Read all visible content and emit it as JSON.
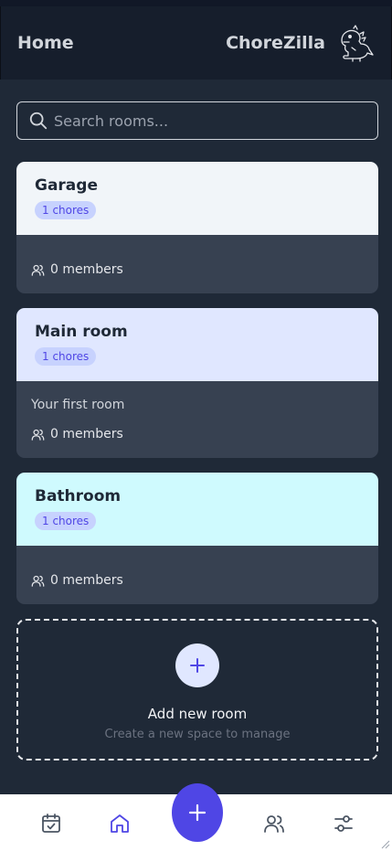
{
  "header": {
    "title": "Home",
    "brand": "ChoreZilla",
    "logo_icon": "dinosaur-icon"
  },
  "search": {
    "placeholder": "Search rooms..."
  },
  "rooms": [
    {
      "name": "Garage",
      "badge": "1 chores",
      "description": "",
      "members": "0 members",
      "color": "#f1f5f9"
    },
    {
      "name": "Main room",
      "badge": "1 chores",
      "description": "Your first room",
      "members": "0 members",
      "color": "#e0e7ff"
    },
    {
      "name": "Bathroom",
      "badge": "1 chores",
      "description": "",
      "members": "0 members",
      "color": "#cffafe"
    }
  ],
  "add_room": {
    "label": "Add new room",
    "sublabel": "Create a new space to manage"
  },
  "nav": {
    "items": [
      {
        "icon": "calendar-check-icon",
        "active": false
      },
      {
        "icon": "home-icon",
        "active": true
      },
      {
        "icon": "users-icon",
        "active": false
      },
      {
        "icon": "settings-sliders-icon",
        "active": false
      }
    ],
    "fab_icon": "plus-icon"
  },
  "colors": {
    "accent": "#4f46e5",
    "background": "#1f2937",
    "header": "#161e2c"
  }
}
